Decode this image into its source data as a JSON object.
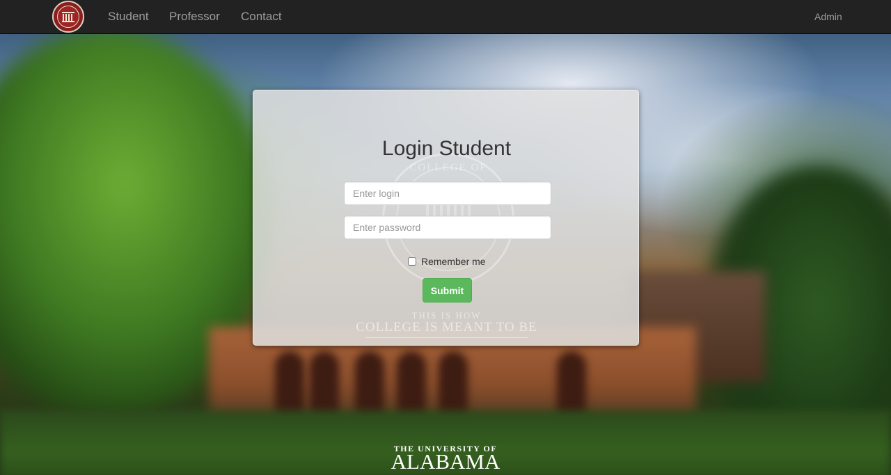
{
  "navbar": {
    "logo_icon": "college-seal-icon",
    "links": [
      {
        "label": "Student"
      },
      {
        "label": "Professor"
      },
      {
        "label": "Contact"
      }
    ],
    "admin_label": "Admin"
  },
  "login": {
    "title": "Login Student",
    "login_placeholder": "Enter login",
    "password_placeholder": "Enter password",
    "remember_label": "Remember me",
    "remember_checked": false,
    "submit_label": "Submit"
  },
  "panel_backdrop": {
    "seal_text": "COLLEGE OF",
    "tagline_small": "THIS IS HOW",
    "tagline_large": "COLLEGE IS MEANT TO BE"
  },
  "footer": {
    "university_prefix": "THE UNIVERSITY OF",
    "university_name": "ALABAMA"
  },
  "colors": {
    "navbar_bg": "#222222",
    "nav_link": "#9d9d9d",
    "submit_bg": "#5cb85c",
    "seal_red": "#8c1d1d"
  }
}
